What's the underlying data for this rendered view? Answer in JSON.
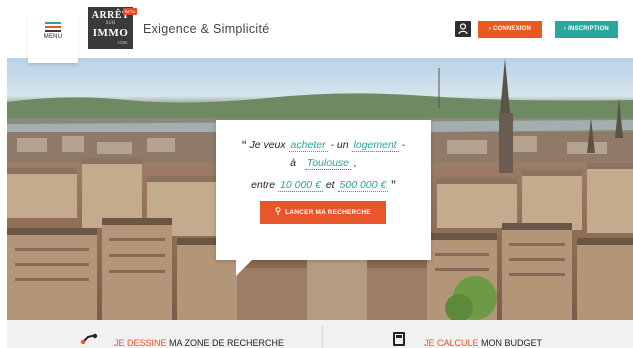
{
  "header": {
    "menu_label": "MENU",
    "logo": {
      "line1": "ARRÊT",
      "line2": "SUR",
      "line3": "IMMO",
      "line4": ".COM",
      "badge": "BETA"
    },
    "tagline": "Exigence & Simplicité",
    "user_icon": "user-icon",
    "connexion_label": "› CONNEXION",
    "inscription_label": "› INSCRIPTION"
  },
  "colors": {
    "accent_orange": "#e85a20",
    "accent_teal": "#2aa79c",
    "menu_stripes": [
      "#2aa79c",
      "#e85a20",
      "#3a3a3a"
    ]
  },
  "search": {
    "open_quote": "“",
    "close_quote": "”",
    "intro": "Je veux",
    "action": "acheter",
    "separator": "- un",
    "property_type": "logement",
    "dash": "-",
    "prefix_city": "à",
    "city": "Toulouse",
    "comma": ",",
    "prefix_budget": "entre",
    "budget_min": "10 000 €",
    "and": "et",
    "budget_max": "500 000 €",
    "button_label": "LANCER MA RECHERCHE",
    "button_icon": "location-pin-icon"
  },
  "features": [
    {
      "icon": "draw-zone-icon",
      "accent": "JE DESSINE",
      "rest": " MA ZONE DE RECHERCHE"
    },
    {
      "icon": "calculator-icon",
      "accent": "JE CALCULE",
      "rest": " MON BUDGET"
    }
  ]
}
